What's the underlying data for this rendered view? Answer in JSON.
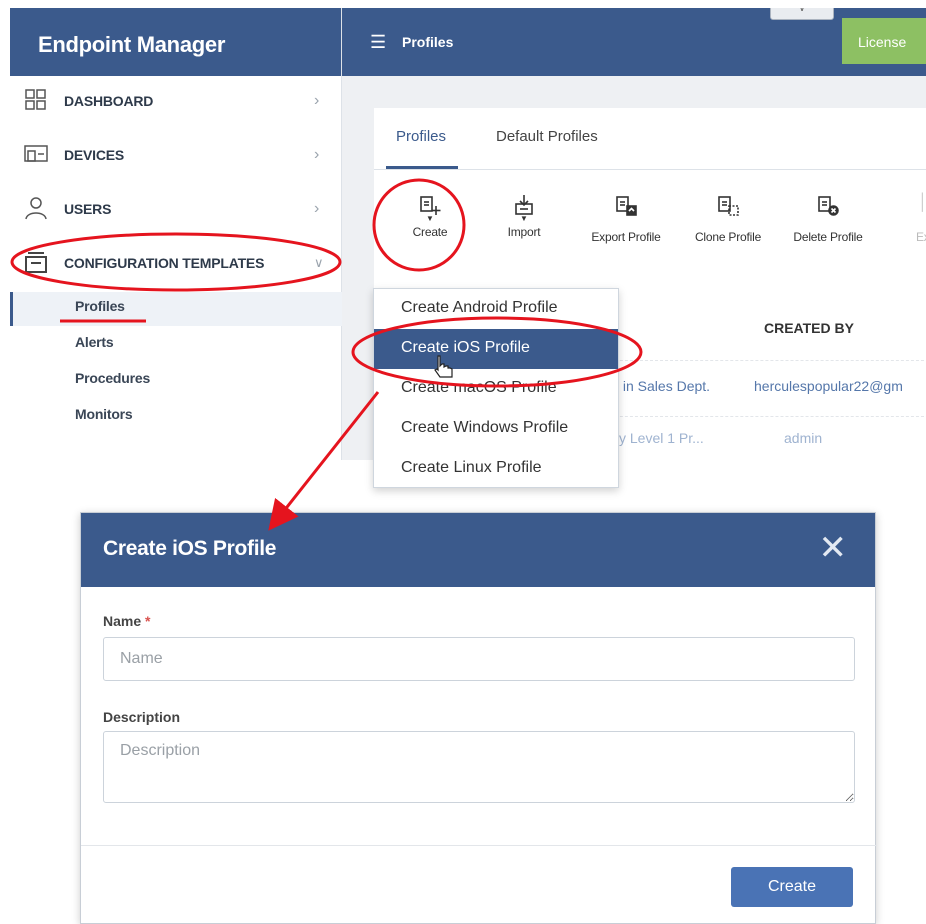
{
  "app": {
    "brand": "Endpoint Manager",
    "page_title": "Profiles",
    "license_button": "License"
  },
  "sidebar": {
    "items": [
      {
        "label": "DASHBOARD",
        "icon": "dashboard-icon"
      },
      {
        "label": "DEVICES",
        "icon": "devices-icon"
      },
      {
        "label": "USERS",
        "icon": "user-icon"
      },
      {
        "label": "CONFIGURATION TEMPLATES",
        "icon": "templates-icon"
      }
    ],
    "subitems": [
      "Profiles",
      "Alerts",
      "Procedures",
      "Monitors"
    ],
    "active_subitem": "Profiles"
  },
  "tabs": [
    "Profiles",
    "Default Profiles"
  ],
  "toolbar": {
    "create": "Create",
    "import": "Import",
    "export": "Export Profile",
    "clone": "Clone Profile",
    "delete": "Delete Profile",
    "export_cut": "Ex"
  },
  "table": {
    "created_by_header": "CREATED BY",
    "rows": [
      {
        "name_fragment": "s in Sales Dept.",
        "created_by": "herculespopular22@gm"
      },
      {
        "name_fragment": "ity Level 1 Pr...",
        "created_by": "admin"
      }
    ]
  },
  "dropdown": {
    "items": [
      "Create Android Profile",
      "Create iOS Profile",
      "Create macOS Profile",
      "Create Windows Profile",
      "Create Linux Profile"
    ],
    "highlighted": "Create iOS Profile"
  },
  "dialog": {
    "title": "Create iOS Profile",
    "close_glyph": "✕",
    "name_label": "Name",
    "required_mark": "*",
    "name_placeholder": "Name",
    "name_value": "",
    "description_label": "Description",
    "description_placeholder": "Description",
    "description_value": "",
    "submit_label": "Create"
  },
  "colors": {
    "header_blue": "#3b5a8c",
    "license_green": "#8dc063",
    "highlight_blue": "#3b5a8c",
    "button_blue": "#4a73b5",
    "annotation_red": "#e5141e"
  }
}
